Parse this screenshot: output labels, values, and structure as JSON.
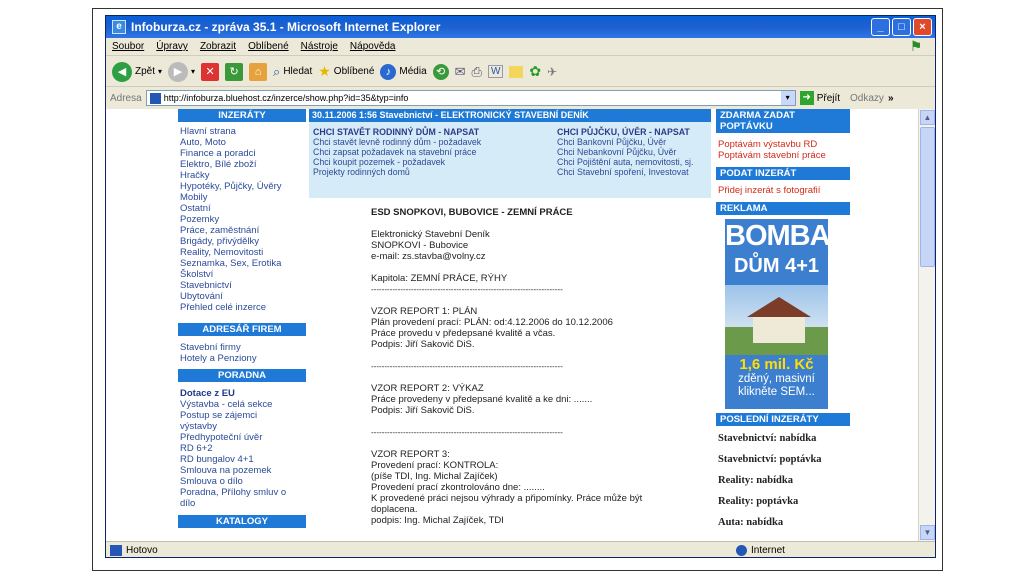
{
  "window": {
    "title": "Infoburza.cz - zpráva 35.1 - Microsoft Internet Explorer"
  },
  "menu": [
    "Soubor",
    "Úpravy",
    "Zobrazit",
    "Oblíbené",
    "Nástroje",
    "Nápověda"
  ],
  "toolbar": {
    "back": "Zpět",
    "search": "Hledat",
    "favorites": "Oblíbené",
    "media": "Média"
  },
  "address": {
    "label": "Adresa",
    "url": "http://infoburza.bluehost.cz/inzerce/show.php?id=35&typ=info",
    "go": "Přejít",
    "links": "Odkazy"
  },
  "status": {
    "left": "Hotovo",
    "zone": "Internet"
  },
  "left": {
    "inzeraty_hdr": "INZERÁTY",
    "inzeraty": [
      "Hlavní strana",
      "Auto, Moto",
      "Finance a poradci",
      "Elektro, Bílé zboží",
      "Hračky",
      "Hypotéky, Půjčky, Úvěry",
      "Mobily",
      "Ostatní",
      "Pozemky",
      "Práce, zaměstnání",
      "Brigády, přivýdělky",
      "Reality, Nemovitosti",
      "Seznamka, Sex, Erotika",
      "Školství",
      "Stavebnictví",
      "Ubytování",
      "Přehled celé inzerce"
    ],
    "adresar_hdr": "ADRESÁŘ FIREM",
    "adresar": [
      "Stavební firmy",
      "Hotely a Penziony"
    ],
    "poradna_hdr": "PORADNA",
    "poradna_bold": "Dotace z EU",
    "poradna": [
      "Výstavba - celá sekce",
      "Postup se zájemci",
      "výstavby",
      "Předhypoteční úvěr",
      "RD 6+2",
      "RD bungalov 4+1",
      "Smlouva na pozemek",
      "Smlouva o dílo",
      "Poradna, Přílohy smluv o",
      "dílo"
    ],
    "katalog_hdr": "KATALOGY"
  },
  "main": {
    "header": "30.11.2006 1:56 Stavebnictví - ELEKTRONICKÝ STAVEBNÍ DENÍK",
    "col1_title": "CHCI STAVĚT RODINNÝ DŮM - NAPSAT",
    "col1": [
      "Chci stavět levně rodinný dům - požadavek",
      "Chci zapsat požadavek na stavební práce",
      "Chci koupit pozemek - požadavek",
      "Projekty rodinných domů"
    ],
    "col2_title": "CHCI PŮJČKU, ÚVĚR - NAPSAT",
    "col2": [
      "Chci Bankovní Půjčku, Úvěr",
      "Chci Nebankovní Půjčku, Úvěr",
      "Chci Pojištění auta, nemovitosti, sj.",
      "Chci Stavební spoření, Investovat"
    ],
    "article": {
      "title": "ESD SNOPKOVI, BUBOVICE - ZEMNÍ PRÁCE",
      "lines": [
        "",
        "Elektronický Stavební Deník",
        "SNOPKOVI - Bubovice",
        "e-mail: zs.stavba@volny.cz",
        "",
        "Kapitola: ZEMNÍ PRÁCE, RÝHY",
        "------------------------------------------------------------------------",
        "",
        "VZOR REPORT 1: PLÁN",
        "Plán provedení prací: PLÁN: od:4.12.2006 do 10.12.2006",
        "Práce provedu v předepsané kvalitě a včas.",
        "Podpis: Jiří Sakovič DiS.",
        "",
        "------------------------------------------------------------------------",
        "",
        "VZOR REPORT 2: VÝKAZ",
        "Práce provedeny v předepsané kvalitě a ke dni: .......",
        "Podpis: Jiří Sakovič DiS.",
        "",
        "------------------------------------------------------------------------",
        "",
        "VZOR REPORT 3:",
        "Provedení prací: KONTROLA:",
        "(píše TDI, Ing. Michal Zajíček)",
        "Provedení prací zkontrolováno dne: ........",
        "K provedené práci nejsou výhrady a připomínky. Práce může být",
        "doplacena.",
        "podpis: Ing. Michal Zajíček, TDI"
      ]
    }
  },
  "right": {
    "zdarma_hdr": "ZDARMA ZADAT POPTÁVKU",
    "zdarma": [
      "Poptávám výstavbu RD",
      "Poptávám stavební práce"
    ],
    "podat_hdr": "PODAT INZERÁT",
    "podat": "Přidej inzerát s fotografií",
    "reklama_hdr": "REKLAMA",
    "ad": {
      "line1": "BOMBA",
      "line2": "DŮM 4+1",
      "price": "1,6 mil. Kč",
      "sub1": "zděný, masivní",
      "sub2": "klikněte SEM..."
    },
    "posledni_hdr": "POSLEDNÍ INZERÁTY",
    "posledni": [
      "Stavebnictví: nabídka",
      "Stavebnictví: poptávka",
      "Reality: nabídka",
      "Reality: poptávka",
      "Auta: nabídka"
    ]
  }
}
